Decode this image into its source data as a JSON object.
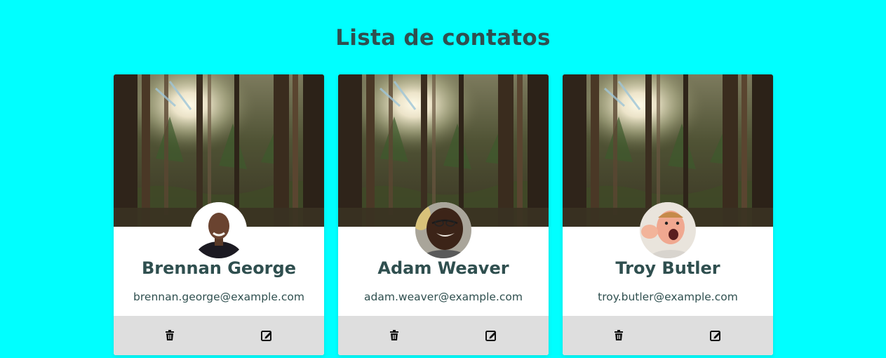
{
  "page": {
    "title": "Lista de contatos"
  },
  "colors": {
    "background": "#00ffff",
    "text": "#2f4f4f",
    "card": "#ffffff",
    "card_footer": "#dedede"
  },
  "contacts": [
    {
      "name": "Brennan George",
      "email": "brennan.george@example.com",
      "avatar": "avatar-brennan-george",
      "cover": "forest-cover-image"
    },
    {
      "name": "Adam Weaver",
      "email": "adam.weaver@example.com",
      "avatar": "avatar-adam-weaver",
      "cover": "forest-cover-image"
    },
    {
      "name": "Troy Butler",
      "email": "troy.butler@example.com",
      "avatar": "avatar-troy-butler",
      "cover": "forest-cover-image"
    }
  ],
  "icons": {
    "delete": "trash-icon",
    "edit": "edit-icon"
  }
}
